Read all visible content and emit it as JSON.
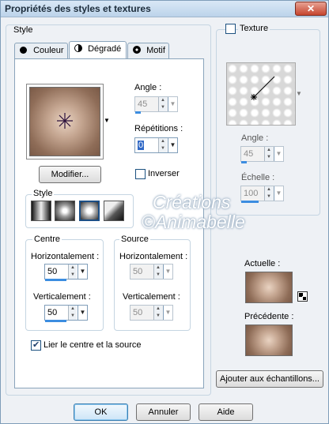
{
  "window": {
    "title": "Propriétés des styles et textures",
    "close": "✕"
  },
  "style_group": {
    "label": "Style",
    "tabs": [
      {
        "label": "Couleur"
      },
      {
        "label": "Dégradé"
      },
      {
        "label": "Motif"
      }
    ],
    "active_tab": "Dégradé"
  },
  "gradient": {
    "angle_label": "Angle :",
    "angle_value": "45",
    "repetitions_label": "Répétitions :",
    "repetitions_value": "0",
    "modify_button": "Modifier...",
    "invert_label": "Inverser",
    "invert_checked": false,
    "style_label": "Style",
    "center": {
      "label": "Centre",
      "horizontal_label": "Horizontalement :",
      "horizontal_value": "50",
      "vertical_label": "Verticalement :",
      "vertical_value": "50"
    },
    "source": {
      "label": "Source",
      "horizontal_label": "Horizontalement :",
      "horizontal_value": "50",
      "vertical_label": "Verticalement :",
      "vertical_value": "50"
    },
    "link_label": "Lier le centre et la source",
    "link_checked": true
  },
  "texture": {
    "label": "Texture",
    "checked": false,
    "angle_label": "Angle :",
    "angle_value": "45",
    "scale_label": "Échelle :",
    "scale_value": "100"
  },
  "current_label": "Actuelle :",
  "previous_label": "Précédente :",
  "add_swatches_button": "Ajouter aux échantillons...",
  "buttons": {
    "ok": "OK",
    "cancel": "Annuler",
    "help": "Aide"
  },
  "watermark": {
    "line1": "Créations",
    "line2": "©Animabelle"
  },
  "colors": {
    "gradient_dark": "#7a5a47",
    "gradient_light": "#e9d3c2",
    "accent_blue": "#3c8de0"
  }
}
